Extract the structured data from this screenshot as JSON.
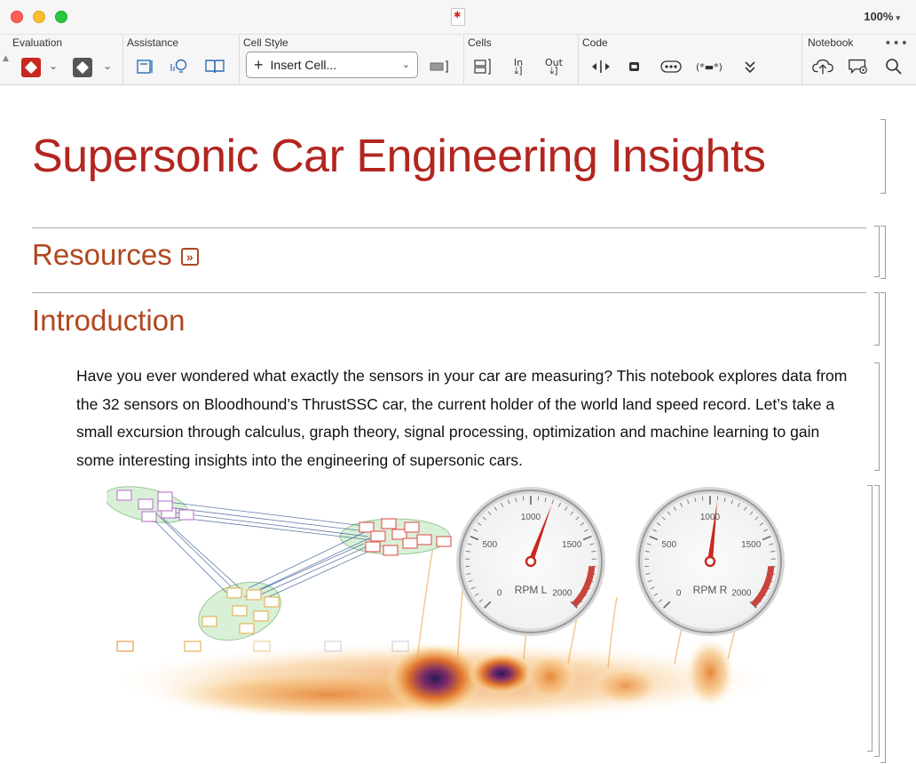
{
  "window": {
    "zoom": "100%"
  },
  "toolbar": {
    "groups": {
      "evaluation": "Evaluation",
      "assistance": "Assistance",
      "cell_style": "Cell Style",
      "cells": "Cells",
      "code": "Code",
      "notebook": "Notebook"
    },
    "insert_cell": "Insert Cell...",
    "code_labels": {
      "in": "In",
      "out": "Out",
      "dots": "•••",
      "star": "(*▬*)"
    }
  },
  "notebook": {
    "title": "Supersonic Car Engineering Insights",
    "sections": {
      "resources": "Resources",
      "introduction": "Introduction"
    },
    "intro_text": "Have you ever wondered what exactly the sensors in your car are measuring? This notebook explores data from the 32 sensors on Bloodhound’s ThrustSSC car, the current holder of the world land speed record. Let’s take a small excursion through calculus, graph theory, signal processing, optimization and machine learning to gain some interesting insights into the engineering of supersonic cars."
  },
  "figure": {
    "gauges": [
      {
        "label": "RPM L",
        "ticks": [
          "0",
          "500",
          "1000",
          "1500",
          "2000"
        ],
        "value": 1150,
        "max": 2000
      },
      {
        "label": "RPM R",
        "ticks": [
          "0",
          "500",
          "1000",
          "1500",
          "2000"
        ],
        "value": 1050,
        "max": 2000
      }
    ]
  },
  "colors": {
    "title": "#b2261f",
    "section": "#b0471f",
    "accent_red": "#c7281f"
  }
}
